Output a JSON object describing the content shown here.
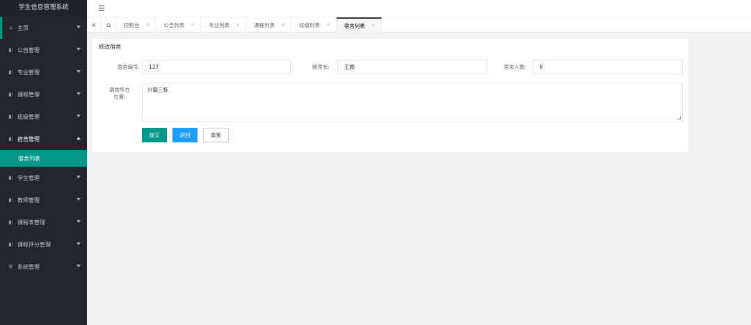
{
  "app": {
    "title": "学生信息管理系统"
  },
  "sidebar": {
    "items": [
      {
        "label": "主页"
      },
      {
        "label": "公告管理"
      },
      {
        "label": "专业管理"
      },
      {
        "label": "课程管理"
      },
      {
        "label": "班级管理"
      },
      {
        "label": "宿舍管理",
        "sub": [
          "宿舍列表"
        ]
      },
      {
        "label": "学生管理"
      },
      {
        "label": "教师管理"
      },
      {
        "label": "课程表管理"
      },
      {
        "label": "课程评分管理"
      },
      {
        "label": "系统管理"
      }
    ]
  },
  "tabs": [
    "控制台",
    "公告列表",
    "专业列表",
    "课程列表",
    "班级列表",
    "宿舍列表"
  ],
  "form": {
    "title": "修改宿舍",
    "dorm_no_label": "宿舍编号:",
    "dorm_no_value": "127",
    "leader_label": "寝室长:",
    "leader_value": "王鹏",
    "count_label": "宿舍人数:",
    "count_value": "8",
    "location_label": "宿舍所在位置:",
    "location_value": "兴霸三栋"
  },
  "buttons": {
    "submit": "提交",
    "back": "返回",
    "reset": "重置"
  },
  "colors": {
    "sidebar_bg": "#23262e",
    "accent_green": "#009688",
    "accent_blue": "#1e9fff"
  },
  "icons": {
    "menu_fold": "menu-fold-icon",
    "home": "home-icon",
    "double_left": "double-left-icon"
  }
}
